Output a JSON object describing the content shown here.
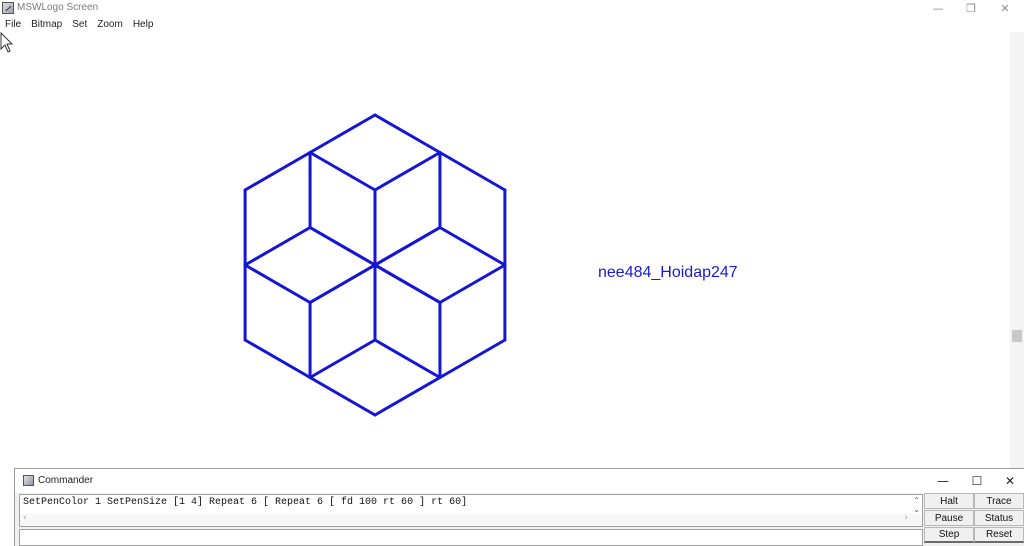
{
  "window": {
    "title": "MSWLogo Screen",
    "minimize_glyph": "—",
    "restore_glyph": "❐",
    "close_glyph": "✕"
  },
  "menu": {
    "items": [
      "File",
      "Bitmap",
      "Set",
      "Zoom",
      "Help"
    ]
  },
  "canvas": {
    "turtle_label": "nee484_Hoidap247",
    "pen_color": "#1515d4",
    "pen_size": 3,
    "repeat_outer": 6,
    "repeat_inner": 6,
    "forward": 100,
    "turn": 60
  },
  "commander": {
    "title": "Commander",
    "minimize_glyph": "—",
    "maximize_glyph": "☐",
    "close_glyph": "✕",
    "history": "SetPenColor 1 SetPenSize [1 4] Repeat 6 [ Repeat 6 [ fd 100 rt 60 ] rt 60]",
    "input_value": "",
    "buttons": {
      "halt": "Halt",
      "trace": "Trace",
      "pause": "Pause",
      "status": "Status",
      "step": "Step",
      "reset": "Reset"
    }
  },
  "icons": {
    "app": "logo-app-icon",
    "commander": "commander-app-icon",
    "cursor": "mouse-pointer-icon"
  }
}
